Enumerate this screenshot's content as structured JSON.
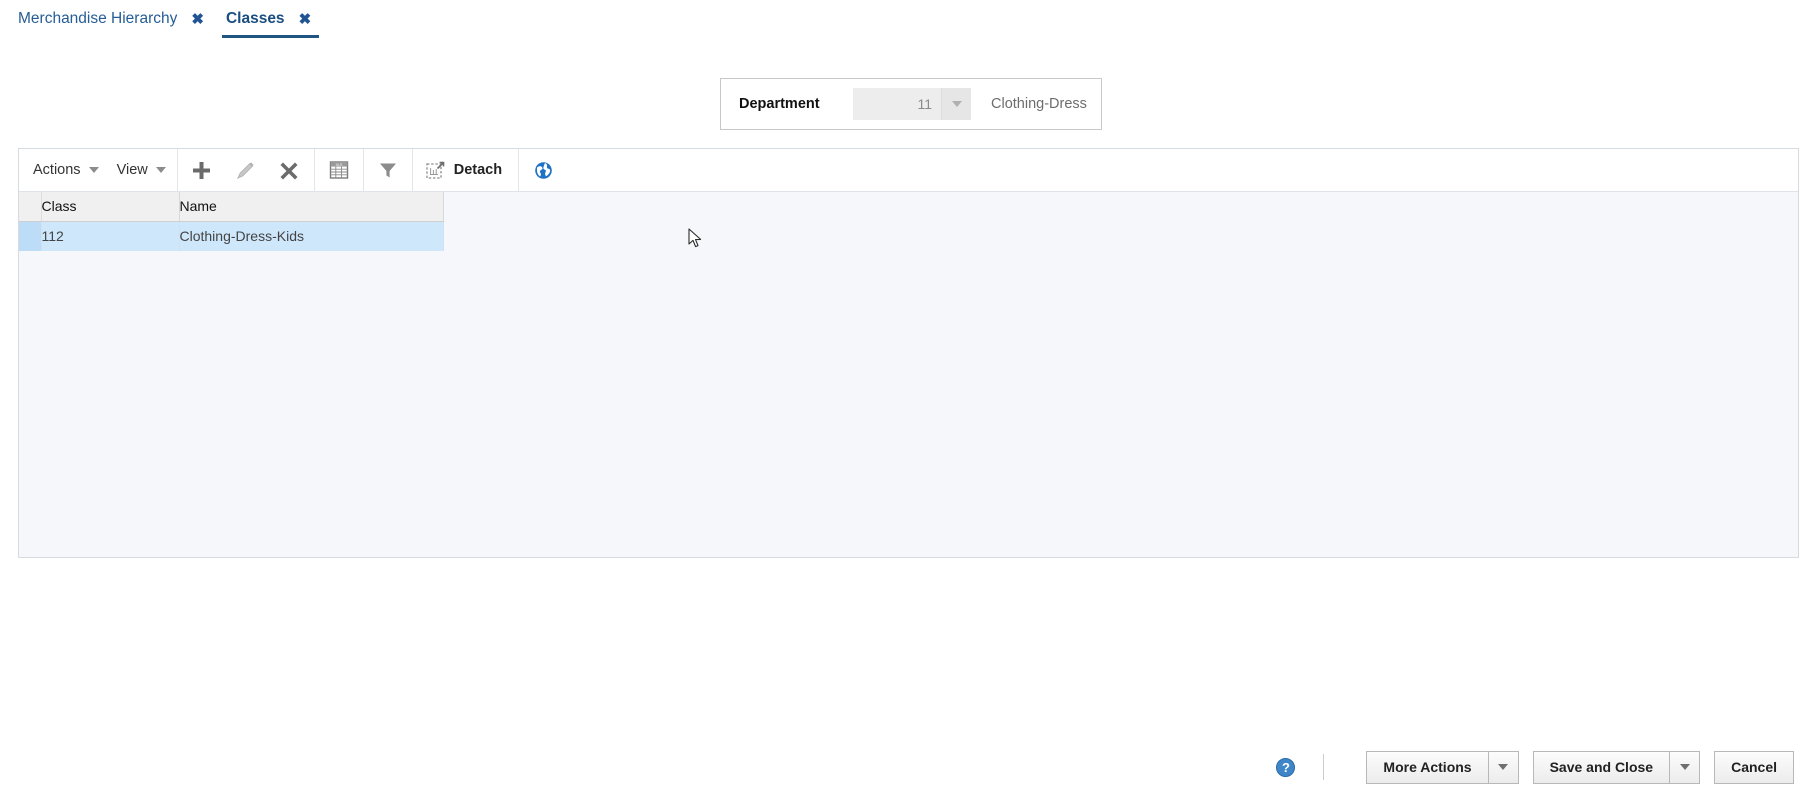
{
  "tabs": [
    {
      "label": "Merchandise Hierarchy",
      "close": "✖",
      "active": false
    },
    {
      "label": "Classes",
      "close": "✖",
      "active": true
    }
  ],
  "department": {
    "label": "Department",
    "id_value": "11",
    "id_placeholder": "",
    "name_value": "Clothing-Dress",
    "dropdown_icon": "chevron-down-icon"
  },
  "toolbar": {
    "actions_label": "Actions",
    "view_label": "View",
    "detach_label": "Detach",
    "icons": {
      "add": "plus-icon",
      "edit": "pencil-icon",
      "delete": "x-icon",
      "export": "export-to-excel-icon",
      "filter": "funnel-icon",
      "detach": "detach-icon",
      "translate": "globe-icon"
    }
  },
  "table": {
    "columns": [
      "Class",
      "Name"
    ],
    "rows": [
      {
        "class": "112",
        "name": "Clothing-Dress-Kids",
        "selected": true
      }
    ]
  },
  "actionbar": {
    "help_label": "?",
    "more_actions_label": "More Actions",
    "save_and_close_label": "Save and Close",
    "cancel_label": "Cancel"
  },
  "colors": {
    "tab_accent": "#1f5582",
    "tab_link": "#265d96",
    "row_selected": "#cfe7fb",
    "panel_bg": "#f5f7fa",
    "globe_blue": "#1f72c4"
  }
}
